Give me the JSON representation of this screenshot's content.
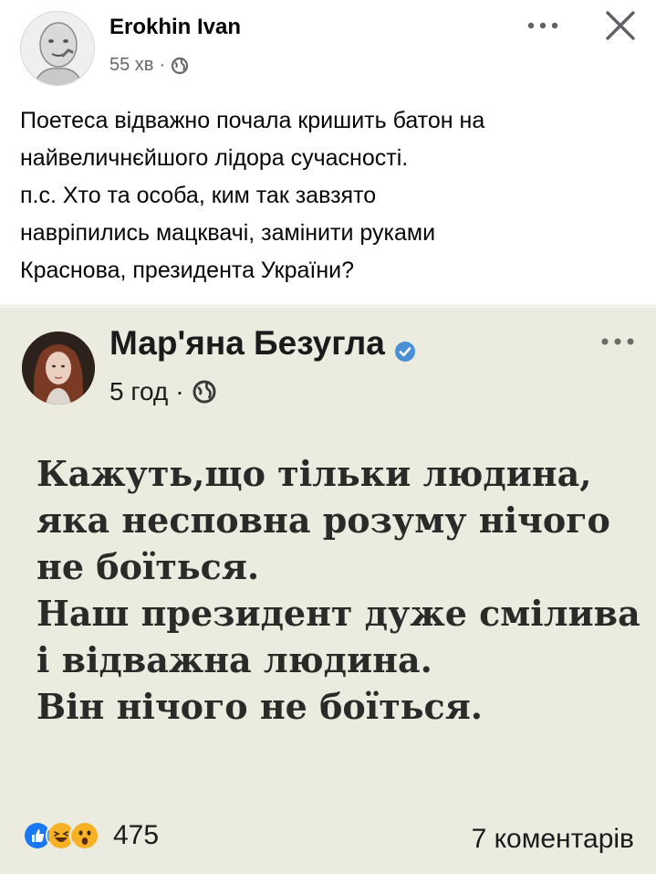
{
  "post": {
    "author": "Erokhin Ivan",
    "time": "55 хв",
    "separator": "·",
    "privacy_icon": "globe-icon",
    "text_lines": [
      "Поетеса відважно почала кришить батон на",
      "найвеличнєйшого лідора сучасності.",
      "п.с. Хто та особа, ким так завзято",
      "навріпились мацквачі, замінити руками",
      "Краснова, президента України?"
    ]
  },
  "shared": {
    "author": "Мар'яна Безугла",
    "verified_icon": "verified-badge-icon",
    "time": "5 год",
    "separator": "·",
    "privacy_icon": "globe-icon",
    "quote_lines": [
      "Кажуть,що тільки людина,",
      "яка несповна розуму нічого",
      "не боїться.",
      "Наш президент дуже смілива",
      "і відважна людина.",
      "Він нічого не боїться."
    ],
    "reactions": [
      "like-icon",
      "haha-icon",
      "wow-icon"
    ],
    "reaction_count": "475",
    "comments": "7 коментарів"
  },
  "colors": {
    "shared_background": "#ecebe0",
    "meta_gray": "#65676b",
    "like_blue": "#1877f2",
    "reaction_yellow": "#f7b125",
    "verified_blue": "#4a8fd6"
  }
}
